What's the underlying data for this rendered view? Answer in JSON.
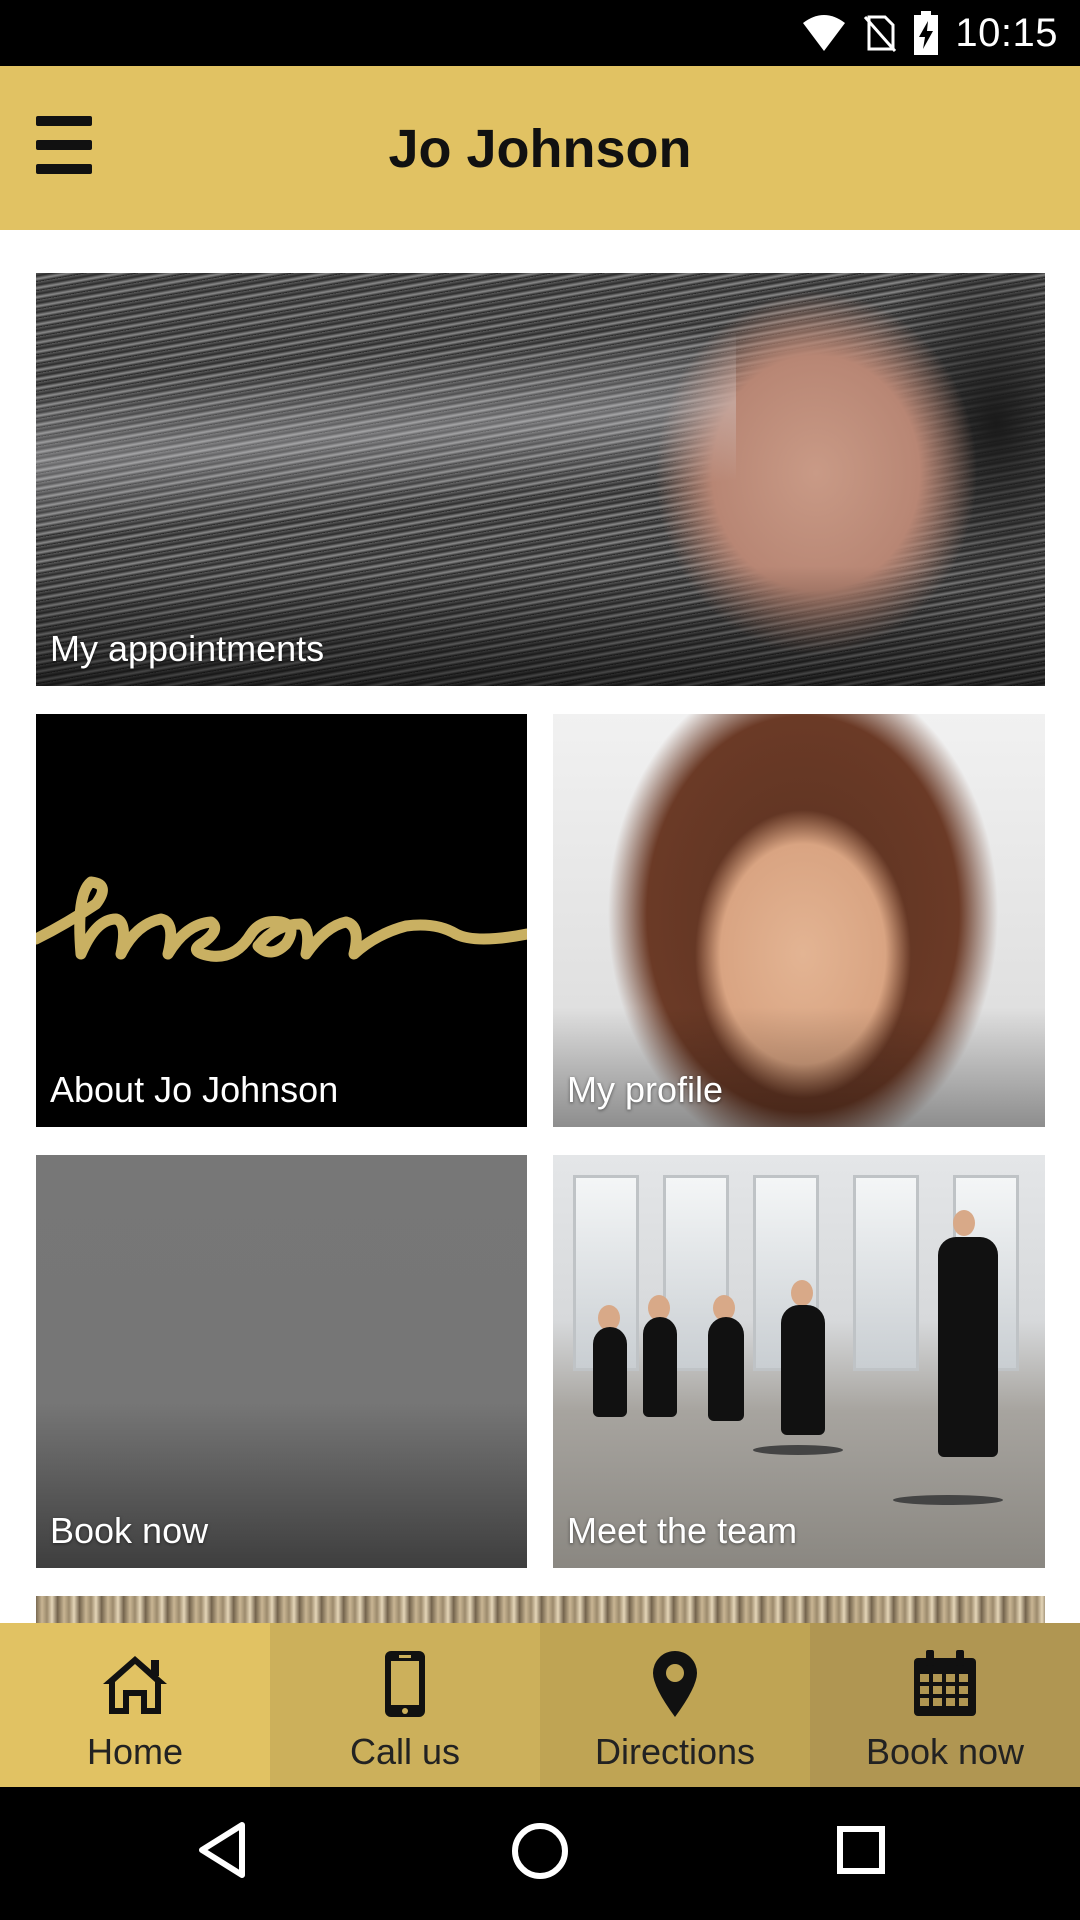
{
  "status_bar": {
    "time": "10:15",
    "icons": [
      "wifi-icon",
      "no-sim-icon",
      "battery-charging-icon"
    ]
  },
  "app_bar": {
    "title": "Jo Johnson",
    "menu_icon": "hamburger-menu-icon"
  },
  "tiles": [
    {
      "label": "My appointments"
    },
    {
      "label": "About Jo Johnson",
      "logo_text": "hnson"
    },
    {
      "label": "My profile"
    },
    {
      "label": "Book now"
    },
    {
      "label": "Meet the team"
    }
  ],
  "bottom_nav": [
    {
      "label": "Home",
      "icon": "home-icon"
    },
    {
      "label": "Call us",
      "icon": "phone-icon"
    },
    {
      "label": "Directions",
      "icon": "map-pin-icon"
    },
    {
      "label": "Book now",
      "icon": "calendar-icon"
    }
  ],
  "android_nav": [
    "back-icon",
    "home-circle-icon",
    "recents-icon"
  ],
  "colors": {
    "accent": "#e1c263",
    "nav_call": "#ccb05b",
    "nav_directions": "#bfa454",
    "nav_book": "#b09652",
    "logo_gold": "#c9b062"
  }
}
